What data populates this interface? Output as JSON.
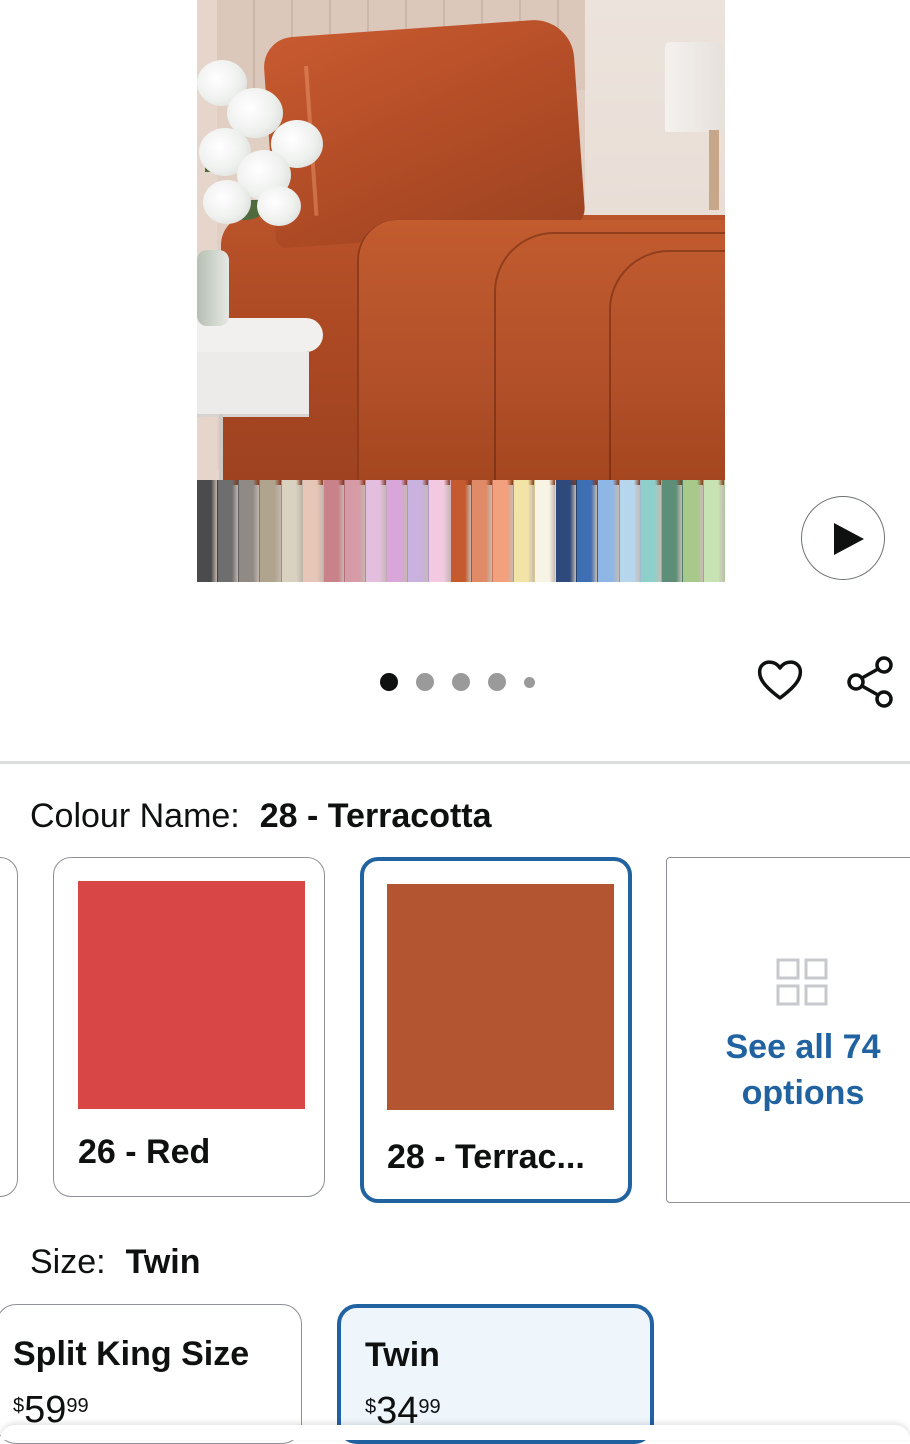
{
  "gallery": {
    "swatch_colors": [
      "#4b4b4d",
      "#6e6e6e",
      "#8f8a83",
      "#b0a48f",
      "#d9d2c1",
      "#e6c6b7",
      "#c9818a",
      "#d79aa7",
      "#e3bede",
      "#d9a6d9",
      "#c9b1e0",
      "#f2c9e1",
      "#c45a2e",
      "#e08a67",
      "#f3a07e",
      "#f3e3a6",
      "#f7f4e6",
      "#2e4a7c",
      "#3f6fb3",
      "#8fb7e6",
      "#b6d6ee",
      "#8fcfc9",
      "#5d8f78",
      "#a7c98a",
      "#c8e3b3"
    ],
    "dot_count": 5,
    "active_dot": 0
  },
  "icons": {
    "play": "play-icon",
    "wishlist": "heart-icon",
    "share": "share-icon",
    "see_all": "grid-icon"
  },
  "colour": {
    "label": "Colour Name:",
    "value": "28 - Terracotta",
    "options": [
      {
        "label": "26 - Red",
        "color": "#d84646"
      },
      {
        "label": "28 - Terrac...",
        "color": "#b45531",
        "selected": true
      }
    ],
    "see_all": {
      "line1": "See all 74",
      "line2": "options"
    }
  },
  "size": {
    "label": "Size:",
    "value": "Twin",
    "options": [
      {
        "name": "Split King Size",
        "currency": "$",
        "whole": "59",
        "fraction": "99"
      },
      {
        "name": "Twin",
        "currency": "$",
        "whole": "34",
        "fraction": "99",
        "selected": true
      }
    ]
  },
  "colors": {
    "accent": "#2162a1",
    "selected_bg": "#eef6fb",
    "text": "#0f1111",
    "border": "#8d9096"
  }
}
